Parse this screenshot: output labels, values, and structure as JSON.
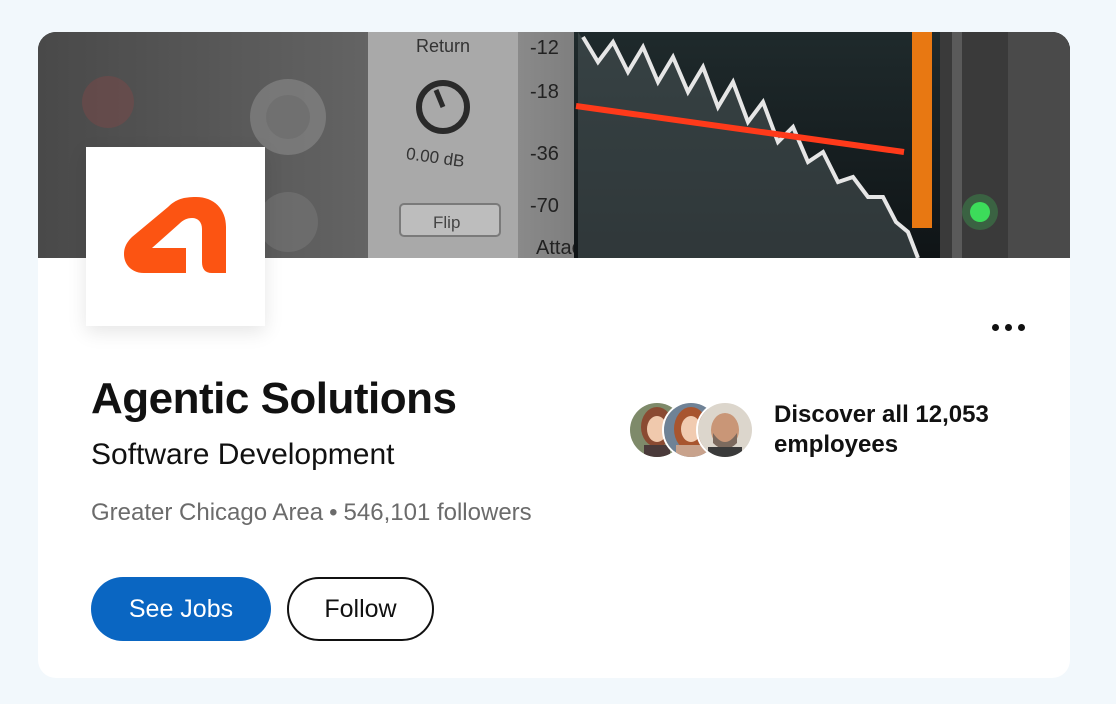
{
  "company": {
    "name": "Agentic Solutions",
    "industry": "Software Development",
    "location": "Greater Chicago Area",
    "separator": "•",
    "followers": "546,101 followers",
    "brand_color": "#fc5412"
  },
  "banner": {
    "image": "audio-compressor-plugin-photo",
    "meter_labels": [
      "-12",
      "-18",
      "-36",
      "-70"
    ],
    "knob_label": "Return",
    "knob_value": "0.00 dB",
    "flip_label": "Flip",
    "attack_label": "Attack"
  },
  "actions": {
    "see_jobs_label": "See Jobs",
    "follow_label": "Follow",
    "more_icon": "more-horizontal-icon"
  },
  "employees": {
    "text": "Discover all 12,053 employees",
    "avatar_count": 3
  },
  "colors": {
    "primary_button": "#0a66c2",
    "background": "#f2f8fc",
    "card": "#ffffff"
  }
}
